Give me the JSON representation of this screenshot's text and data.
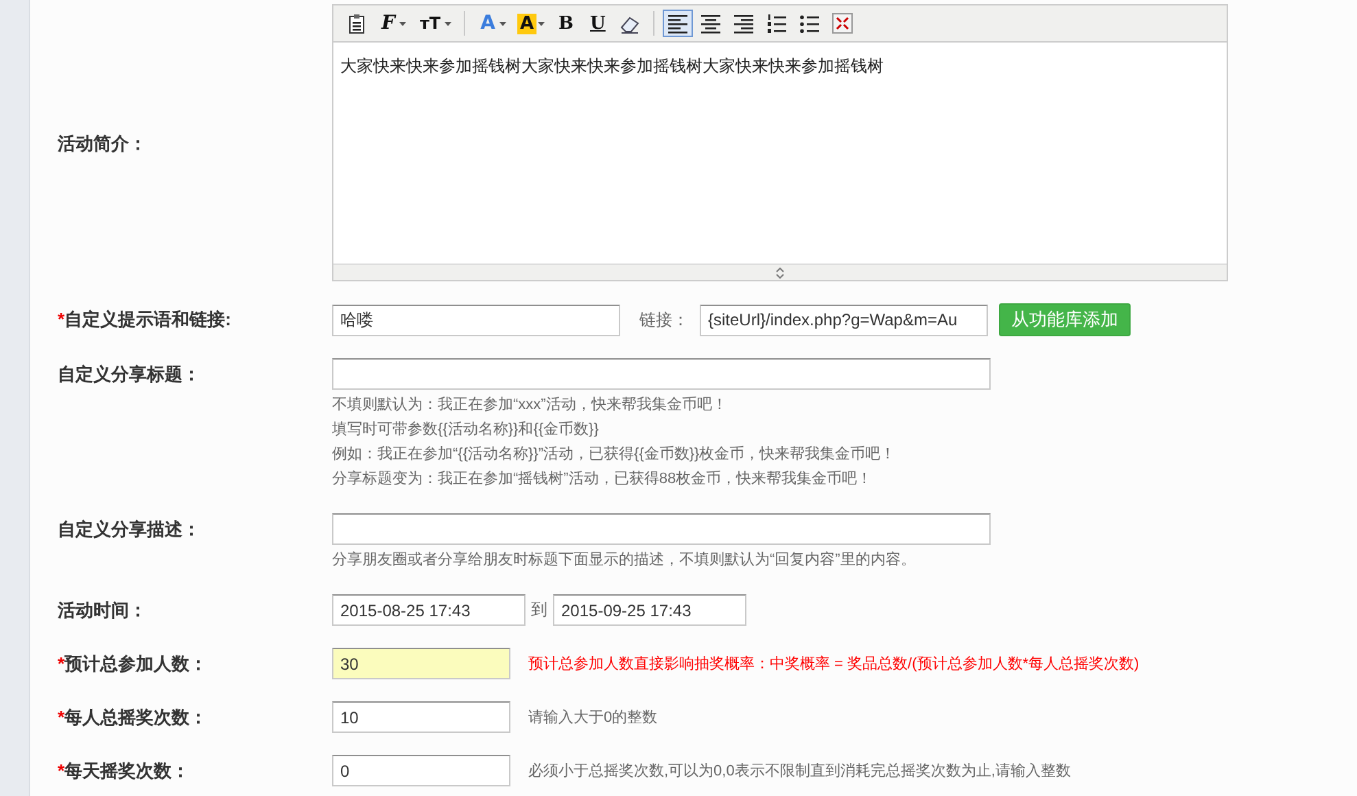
{
  "rows": [
    {
      "kind": "editor",
      "label": {
        "text": "活动简介："
      },
      "editor": {
        "toolbar": [
          {
            "kind": "paste",
            "selected": false
          },
          {
            "kind": "font-family",
            "glyph": "F",
            "dropdown": true,
            "selected": false
          },
          {
            "kind": "font-size",
            "glyph": "ᴛT",
            "dropdown": true,
            "selected": false
          },
          {
            "kind": "separator"
          },
          {
            "kind": "font-color",
            "glyph": "A",
            "dropdown": true,
            "selected": false
          },
          {
            "kind": "highlight",
            "glyph": "A",
            "dropdown": true,
            "selected": false
          },
          {
            "kind": "bold",
            "glyph": "B",
            "selected": false
          },
          {
            "kind": "underline",
            "glyph": "U",
            "selected": false
          },
          {
            "kind": "eraser",
            "selected": false
          },
          {
            "kind": "separator"
          },
          {
            "kind": "align-left",
            "selected": true
          },
          {
            "kind": "align-center",
            "selected": false
          },
          {
            "kind": "align-right",
            "selected": false
          },
          {
            "kind": "ordered-list",
            "selected": false
          },
          {
            "kind": "bullet-list",
            "selected": false
          },
          {
            "kind": "fullscreen",
            "selected": false
          }
        ],
        "content": "大家快来快来参加摇钱树大家快来快来参加摇钱树大家快来快来参加摇钱树"
      }
    },
    {
      "kind": "link",
      "label": {
        "mark": "*",
        "text": "自定义提示语和链接:"
      },
      "value": "哈喽",
      "link_label": "链接：",
      "link_value": "{siteUrl}/index.php?g=Wap&m=Au",
      "button": "从功能库添加"
    },
    {
      "kind": "wide-input",
      "label": {
        "text": "自定义分享标题："
      },
      "value": "",
      "hints": [
        "不填则默认为：我正在参加“xxx”活动，快来帮我集金币吧！",
        "填写时可带参数{{活动名称}}和{{金币数}}",
        "例如：我正在参加“{{活动名称}}”活动，已获得{{金币数}}枚金币，快来帮我集金币吧！",
        "分享标题变为：我正在参加“摇钱树”活动，已获得88枚金币，快来帮我集金币吧！"
      ]
    },
    {
      "kind": "wide-input",
      "label": {
        "text": "自定义分享描述："
      },
      "value": "",
      "hints": [
        "分享朋友圈或者分享给朋友时标题下面显示的描述，不填则默认为“回复内容”里的内容。"
      ]
    },
    {
      "kind": "daterange",
      "label": {
        "text": "活动时间："
      },
      "start": "2015-08-25 17:43",
      "separator": "到",
      "end": "2015-09-25 17:43"
    },
    {
      "kind": "short-input",
      "label": {
        "mark": "*",
        "text": "预计总参加人数："
      },
      "value": "30",
      "highlighted": true,
      "note": "预计总参加人数直接影响抽奖概率：中奖概率 = 奖品总数/(预计总参加人数*每人总摇奖次数)",
      "warning": true
    },
    {
      "kind": "short-input",
      "label": {
        "mark": "*",
        "text": "每人总摇奖次数："
      },
      "value": "10",
      "highlighted": false,
      "note": "请输入大于0的整数",
      "warning": false
    },
    {
      "kind": "short-input",
      "label": {
        "mark": "*",
        "text": "每天摇奖次数："
      },
      "value": "0",
      "highlighted": false,
      "note": "必须小于总摇奖次数,可以为0,0表示不限制直到消耗完总摇奖次数为止,请输入整数",
      "warning": false
    }
  ]
}
